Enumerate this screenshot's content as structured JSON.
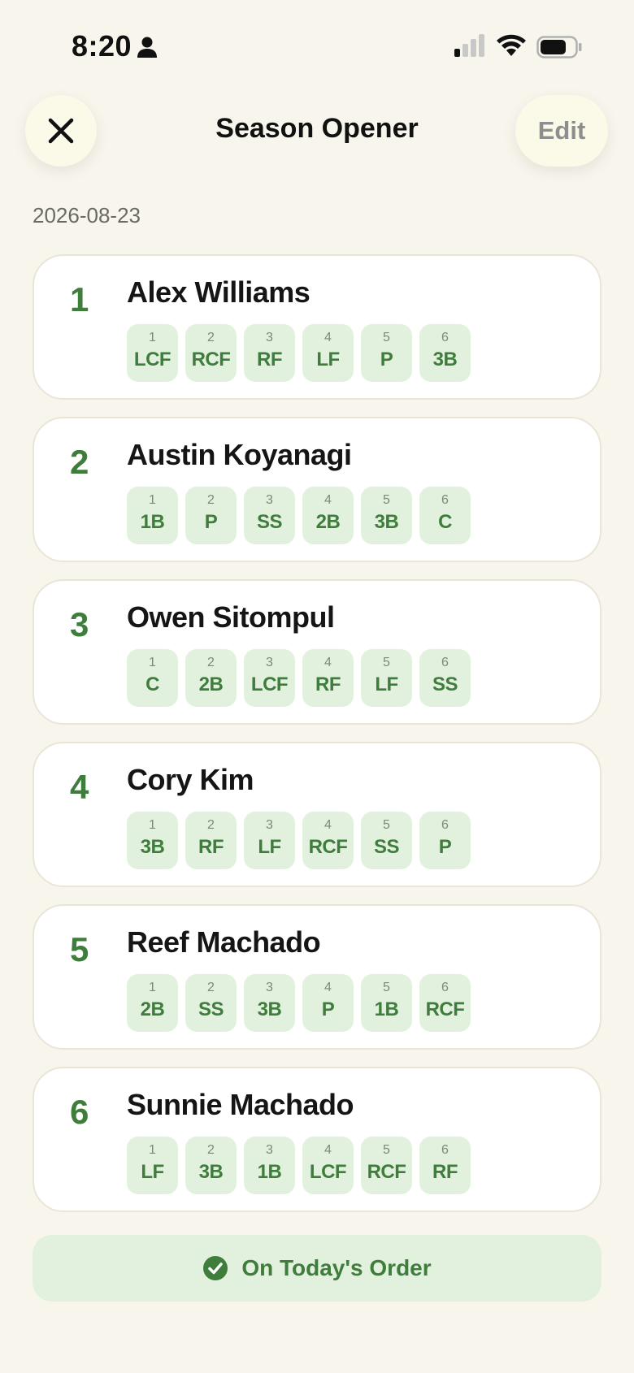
{
  "status_bar": {
    "time": "8:20",
    "icons": [
      "person-icon",
      "cellular-signal-icon",
      "wifi-icon",
      "battery-icon"
    ]
  },
  "header": {
    "close_icon": "close-icon",
    "title": "Season Opener",
    "edit_label": "Edit"
  },
  "date": "2026-08-23",
  "colors": {
    "background": "#f8f6ec",
    "accent_green": "#3f7d3c",
    "pill_bg": "#e1f1de",
    "card_bg": "#ffffff"
  },
  "players": [
    {
      "order": "1",
      "name": "Alex Williams",
      "innings": [
        {
          "inning": "1",
          "pos": "LCF"
        },
        {
          "inning": "2",
          "pos": "RCF"
        },
        {
          "inning": "3",
          "pos": "RF"
        },
        {
          "inning": "4",
          "pos": "LF"
        },
        {
          "inning": "5",
          "pos": "P"
        },
        {
          "inning": "6",
          "pos": "3B"
        }
      ]
    },
    {
      "order": "2",
      "name": "Austin Koyanagi",
      "innings": [
        {
          "inning": "1",
          "pos": "1B"
        },
        {
          "inning": "2",
          "pos": "P"
        },
        {
          "inning": "3",
          "pos": "SS"
        },
        {
          "inning": "4",
          "pos": "2B"
        },
        {
          "inning": "5",
          "pos": "3B"
        },
        {
          "inning": "6",
          "pos": "C"
        }
      ]
    },
    {
      "order": "3",
      "name": "Owen Sitompul",
      "innings": [
        {
          "inning": "1",
          "pos": "C"
        },
        {
          "inning": "2",
          "pos": "2B"
        },
        {
          "inning": "3",
          "pos": "LCF"
        },
        {
          "inning": "4",
          "pos": "RF"
        },
        {
          "inning": "5",
          "pos": "LF"
        },
        {
          "inning": "6",
          "pos": "SS"
        }
      ]
    },
    {
      "order": "4",
      "name": "Cory Kim",
      "innings": [
        {
          "inning": "1",
          "pos": "3B"
        },
        {
          "inning": "2",
          "pos": "RF"
        },
        {
          "inning": "3",
          "pos": "LF"
        },
        {
          "inning": "4",
          "pos": "RCF"
        },
        {
          "inning": "5",
          "pos": "SS"
        },
        {
          "inning": "6",
          "pos": "P"
        }
      ]
    },
    {
      "order": "5",
      "name": "Reef Machado",
      "innings": [
        {
          "inning": "1",
          "pos": "2B"
        },
        {
          "inning": "2",
          "pos": "SS"
        },
        {
          "inning": "3",
          "pos": "3B"
        },
        {
          "inning": "4",
          "pos": "P"
        },
        {
          "inning": "5",
          "pos": "1B"
        },
        {
          "inning": "6",
          "pos": "RCF"
        }
      ]
    },
    {
      "order": "6",
      "name": "Sunnie Machado",
      "innings": [
        {
          "inning": "1",
          "pos": "LF"
        },
        {
          "inning": "2",
          "pos": "3B"
        },
        {
          "inning": "3",
          "pos": "1B"
        },
        {
          "inning": "4",
          "pos": "LCF"
        },
        {
          "inning": "5",
          "pos": "RCF"
        },
        {
          "inning": "6",
          "pos": "RF"
        }
      ]
    }
  ],
  "order_banner": {
    "icon": "check-circle-icon",
    "label": "On Today's Order"
  }
}
